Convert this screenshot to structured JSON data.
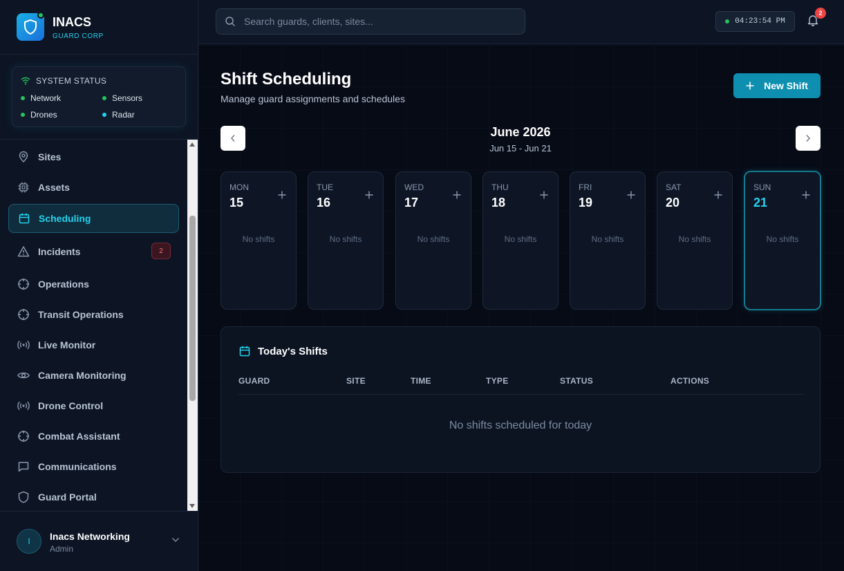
{
  "brand": {
    "name": "INACS",
    "subtitle": "GUARD CORP"
  },
  "system_status": {
    "title": "SYSTEM STATUS",
    "items": [
      {
        "label": "Network",
        "color": "#22c55e"
      },
      {
        "label": "Sensors",
        "color": "#22c55e"
      },
      {
        "label": "Drones",
        "color": "#22c55e"
      },
      {
        "label": "Radar",
        "color": "#22d3ee"
      }
    ]
  },
  "nav": {
    "items": [
      {
        "label": "Sites",
        "icon": "map-pin-icon"
      },
      {
        "label": "Assets",
        "icon": "chip-icon"
      },
      {
        "label": "Scheduling",
        "icon": "calendar-icon",
        "active": true
      },
      {
        "label": "Incidents",
        "icon": "warning-icon",
        "badge": "2"
      },
      {
        "label": "Operations",
        "icon": "crosshair-icon"
      },
      {
        "label": "Transit Operations",
        "icon": "crosshair-icon"
      },
      {
        "label": "Live Monitor",
        "icon": "broadcast-icon"
      },
      {
        "label": "Camera Monitoring",
        "icon": "eye-icon"
      },
      {
        "label": "Drone Control",
        "icon": "broadcast-icon"
      },
      {
        "label": "Combat Assistant",
        "icon": "crosshair-icon"
      },
      {
        "label": "Communications",
        "icon": "message-icon"
      },
      {
        "label": "Guard Portal",
        "icon": "shield-icon"
      }
    ]
  },
  "user": {
    "initial": "I",
    "name": "Inacs Networking",
    "role": "Admin"
  },
  "topbar": {
    "search_placeholder": "Search guards, clients, sites...",
    "clock": "04:23:54 PM",
    "notifications": "2"
  },
  "page": {
    "title": "Shift Scheduling",
    "subtitle": "Manage guard assignments and schedules",
    "new_shift_label": "New Shift"
  },
  "week": {
    "title": "June 2026",
    "range": "Jun 15 - Jun 21",
    "days": [
      {
        "name": "MON",
        "num": "15",
        "empty": "No shifts"
      },
      {
        "name": "TUE",
        "num": "16",
        "empty": "No shifts"
      },
      {
        "name": "WED",
        "num": "17",
        "empty": "No shifts"
      },
      {
        "name": "THU",
        "num": "18",
        "empty": "No shifts"
      },
      {
        "name": "FRI",
        "num": "19",
        "empty": "No shifts"
      },
      {
        "name": "SAT",
        "num": "20",
        "empty": "No shifts"
      },
      {
        "name": "SUN",
        "num": "21",
        "empty": "No shifts",
        "today": true
      }
    ]
  },
  "todays_shifts": {
    "title": "Today's Shifts",
    "columns": [
      "GUARD",
      "SITE",
      "TIME",
      "TYPE",
      "STATUS",
      "ACTIONS"
    ],
    "empty": "No shifts scheduled for today"
  },
  "colors": {
    "accent": "#22d3ee",
    "primary_button": "#0e8fb0",
    "background": "#070b16",
    "sidebar": "#0d1524",
    "danger": "#ef4444"
  }
}
